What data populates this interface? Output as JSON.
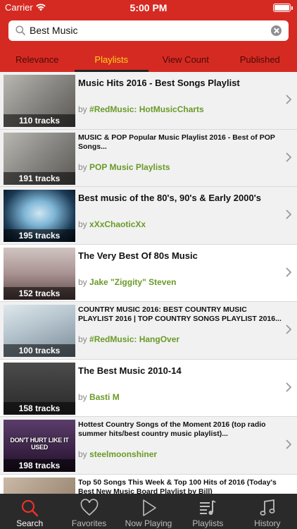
{
  "status": {
    "carrier": "Carrier",
    "time": "5:00 PM"
  },
  "search": {
    "query": "Best Music"
  },
  "tabs": [
    {
      "label": "Relevance",
      "active": false
    },
    {
      "label": "Playlists",
      "active": true
    },
    {
      "label": "View Count",
      "active": false
    },
    {
      "label": "Published",
      "active": false
    }
  ],
  "playlists": [
    {
      "title": "Music Hits 2016 - Best Songs Playlist",
      "by": "by",
      "author": "#RedMusic: HotMusicCharts",
      "tracks": "110 tracks",
      "thumbnail": "room-photo"
    },
    {
      "title": "MUSIC & POP Popular Music Playlist 2016 - Best of POP Songs...",
      "by": "by",
      "author": "POP Music Playlists",
      "tracks": "191 tracks",
      "thumbnail": "room-photo"
    },
    {
      "title": "Best music of the 80's, 90's & Early 2000's",
      "by": "by",
      "author": "xXxChaoticXx",
      "tracks": "195 tracks",
      "thumbnail": "face-closeup"
    },
    {
      "title": "The Very Best Of 80s Music",
      "by": "by",
      "author": "Jake \"Ziggity\" Steven",
      "tracks": "152 tracks",
      "thumbnail": "singer-portrait"
    },
    {
      "title": "COUNTRY MUSIC 2016: BEST COUNTRY MUSIC PLAYLIST 2016 | TOP COUNTRY SONGS PLAYLIST 2016...",
      "by": "by",
      "author": "#RedMusic: HangOver",
      "tracks": "100 tracks",
      "thumbnail": "country-singer"
    },
    {
      "title": "The Best Music 2010-14",
      "by": "by",
      "author": "Basti M",
      "tracks": "158 tracks",
      "thumbnail": "duo-stage"
    },
    {
      "title": "Hottest Country Songs of the Moment 2016 (top radio summer hits/best country music playlist)...",
      "by": "by",
      "author": "steelmoonshiner",
      "tracks": "198 tracks",
      "thumbnail": "dont-hurt-like-it-used"
    },
    {
      "title": "Top 50 Songs This Week & Top 100 Hits of 2016 (Today's Best New Music Board Playlist by Bill)",
      "by": "",
      "author": "",
      "tracks": "",
      "thumbnail": "top-songs"
    }
  ],
  "thumb_overlay_text": "DON'T HURT LIKE IT USED",
  "tabbar": [
    {
      "label": "Search",
      "icon": "search-icon",
      "active": true
    },
    {
      "label": "Favorites",
      "icon": "heart-icon",
      "active": false
    },
    {
      "label": "Now Playing",
      "icon": "play-icon",
      "active": false
    },
    {
      "label": "Playlists",
      "icon": "playlist-icon",
      "active": false
    },
    {
      "label": "History",
      "icon": "music-note-icon",
      "active": false
    }
  ],
  "colors": {
    "brand_red": "#d52a22",
    "active_tab": "#ffd21a",
    "author_green": "#6a9a28",
    "tabbar_bg": "#2a2a2a",
    "active_icon": "#e8322a"
  }
}
